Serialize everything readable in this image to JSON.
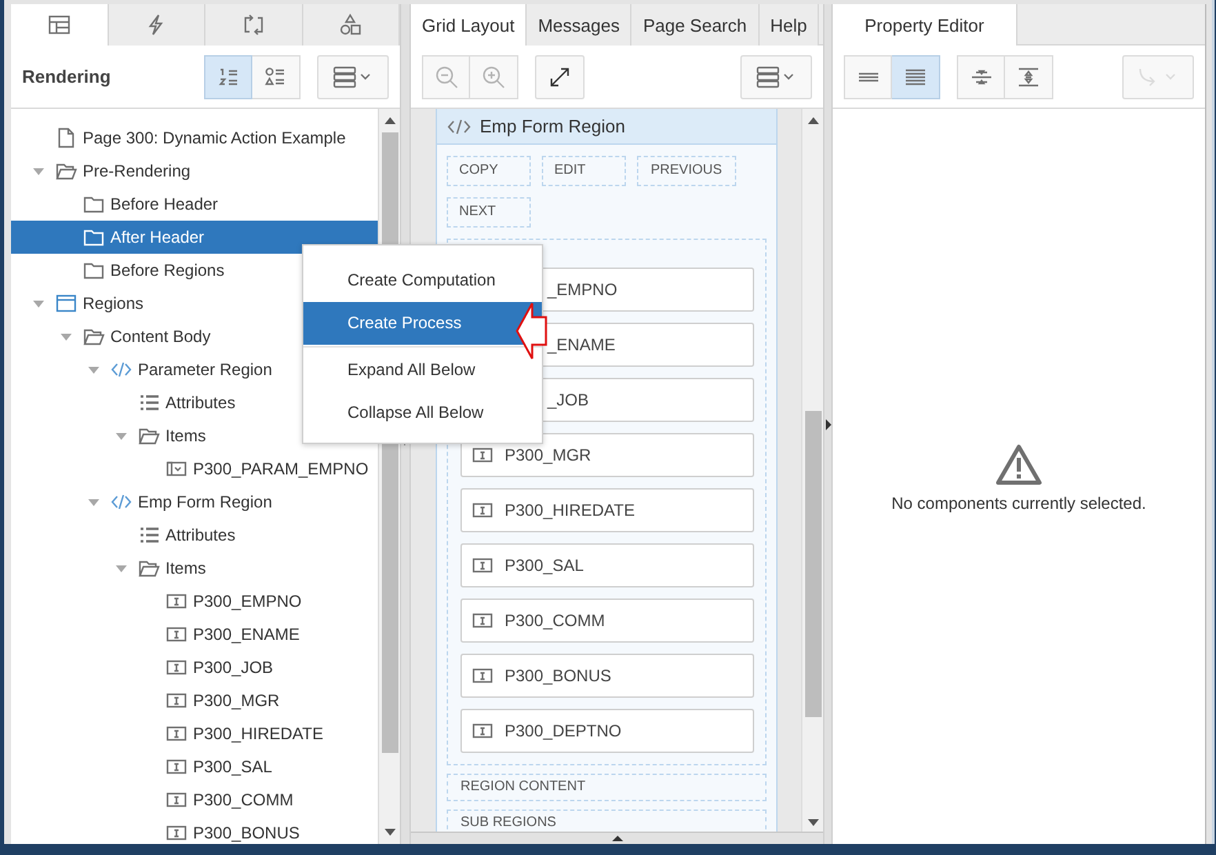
{
  "left_panel": {
    "tabs": [
      {
        "kind": "layout",
        "selected": true
      },
      {
        "kind": "lightning",
        "selected": false
      },
      {
        "kind": "arrows",
        "selected": false
      },
      {
        "kind": "shapes",
        "selected": false
      }
    ],
    "title": "Rendering",
    "view_buttons": [
      {
        "kind": "numbered",
        "selected": true
      },
      {
        "kind": "shapes",
        "selected": false
      }
    ],
    "tree": [
      {
        "label": "Page 300: Dynamic Action Example",
        "kind": "page",
        "selected": false
      },
      {
        "label": "Pre-Rendering",
        "kind": "folder-open",
        "selected": false,
        "expanded": true,
        "children": [
          {
            "label": "Before Header",
            "kind": "folder",
            "selected": false
          },
          {
            "label": "After Header",
            "kind": "folder",
            "selected": true
          },
          {
            "label": "Before Regions",
            "kind": "folder",
            "selected": false
          }
        ]
      },
      {
        "label": "Regions",
        "kind": "region",
        "selected": false,
        "expanded": true,
        "children": [
          {
            "label": "Content Body",
            "kind": "folder-open",
            "selected": false,
            "expanded": true,
            "children": [
              {
                "label": "Parameter Region",
                "kind": "code",
                "selected": false,
                "expanded": true,
                "children": [
                  {
                    "label": "Attributes",
                    "kind": "list",
                    "selected": false
                  },
                  {
                    "label": "Items",
                    "kind": "folder-open",
                    "selected": false,
                    "expanded": true,
                    "children": [
                      {
                        "label": "P300_PARAM_EMPNO",
                        "kind": "select",
                        "selected": false
                      }
                    ]
                  }
                ]
              },
              {
                "label": "Emp Form Region",
                "kind": "code",
                "selected": false,
                "expanded": true,
                "children": [
                  {
                    "label": "Attributes",
                    "kind": "list",
                    "selected": false
                  },
                  {
                    "label": "Items",
                    "kind": "folder-open",
                    "selected": false,
                    "expanded": true,
                    "children": [
                      {
                        "label": "P300_EMPNO",
                        "kind": "text",
                        "selected": false
                      },
                      {
                        "label": "P300_ENAME",
                        "kind": "text",
                        "selected": false
                      },
                      {
                        "label": "P300_JOB",
                        "kind": "text",
                        "selected": false
                      },
                      {
                        "label": "P300_MGR",
                        "kind": "text",
                        "selected": false
                      },
                      {
                        "label": "P300_HIREDATE",
                        "kind": "text",
                        "selected": false
                      },
                      {
                        "label": "P300_SAL",
                        "kind": "text",
                        "selected": false
                      },
                      {
                        "label": "P300_COMM",
                        "kind": "text",
                        "selected": false
                      },
                      {
                        "label": "P300_BONUS",
                        "kind": "text",
                        "selected": false
                      }
                    ]
                  }
                ]
              }
            ]
          }
        ]
      }
    ]
  },
  "context_menu": {
    "items": [
      {
        "label": "Create Computation",
        "selected": false,
        "group_start": false
      },
      {
        "label": "Create Process",
        "selected": true,
        "group_start": false
      },
      {
        "label": "Expand All Below",
        "selected": false,
        "group_start": true
      },
      {
        "label": "Collapse All Below",
        "selected": false,
        "group_start": false
      }
    ]
  },
  "middle_panel": {
    "tabs": [
      {
        "label": "Grid Layout",
        "selected": true
      },
      {
        "label": "Messages",
        "selected": false
      },
      {
        "label": "Page Search",
        "selected": false
      },
      {
        "label": "Help",
        "selected": false
      }
    ],
    "zoom_disabled": true,
    "region": {
      "title": "Emp Form Region",
      "buttons": [
        "COPY",
        "EDIT",
        "PREVIOUS",
        "NEXT"
      ],
      "items": [
        {
          "label": "_EMPNO",
          "kind": "covered"
        },
        {
          "label": "_ENAME",
          "kind": "covered"
        },
        {
          "label": "_JOB",
          "kind": "covered"
        },
        {
          "label": "P300_MGR",
          "kind": "text"
        },
        {
          "label": "P300_HIREDATE",
          "kind": "text"
        },
        {
          "label": "P300_SAL",
          "kind": "text"
        },
        {
          "label": "P300_COMM",
          "kind": "text"
        },
        {
          "label": "P300_BONUS",
          "kind": "text"
        },
        {
          "label": "P300_DEPTNO",
          "kind": "text"
        }
      ],
      "sections": [
        "REGION CONTENT",
        "SUB REGIONS"
      ]
    }
  },
  "right_panel": {
    "tabs": [
      {
        "label": "Property Editor",
        "selected": true
      }
    ],
    "layout_buttons": [
      {
        "kind": "lines",
        "selected": false
      },
      {
        "kind": "lines-dense",
        "selected": true
      },
      {
        "kind": "collapse",
        "selected": false
      },
      {
        "kind": "expand",
        "selected": false
      }
    ],
    "message": "No components currently selected."
  }
}
